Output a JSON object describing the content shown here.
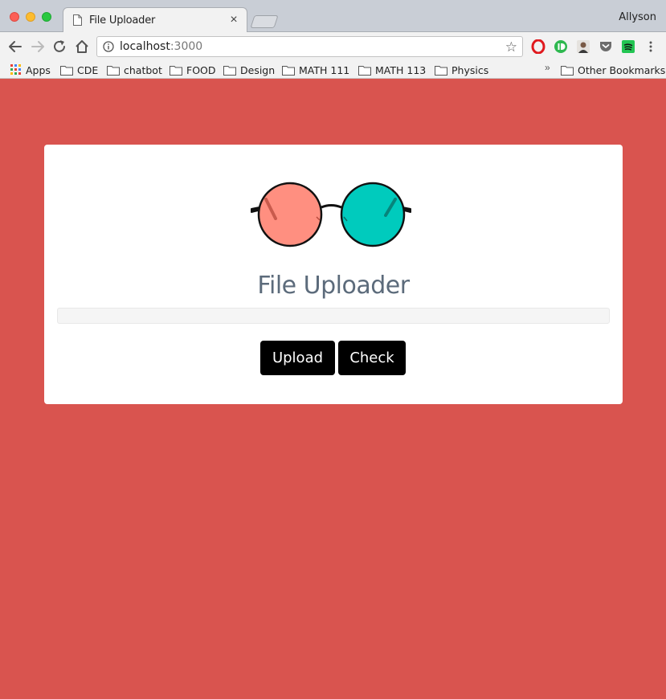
{
  "browser": {
    "tab_title": "File Uploader",
    "profile_name": "Allyson",
    "url_host": "localhost",
    "url_port": ":3000",
    "bookmarks": [
      "Apps",
      "CDE",
      "chatbot",
      "FOOD",
      "Design",
      "MATH 111",
      "MATH 113",
      "Physics"
    ],
    "other_bookmarks": "Other Bookmarks"
  },
  "page": {
    "title": "File Uploader",
    "progress_percent": 0,
    "upload_label": "Upload",
    "check_label": "Check"
  },
  "colors": {
    "page_background": "#d9544f",
    "card": "#ffffff",
    "left_lens": "#ff8f80",
    "right_lens": "#00cbbd",
    "button": "#000000",
    "title": "#5c6b7b"
  }
}
